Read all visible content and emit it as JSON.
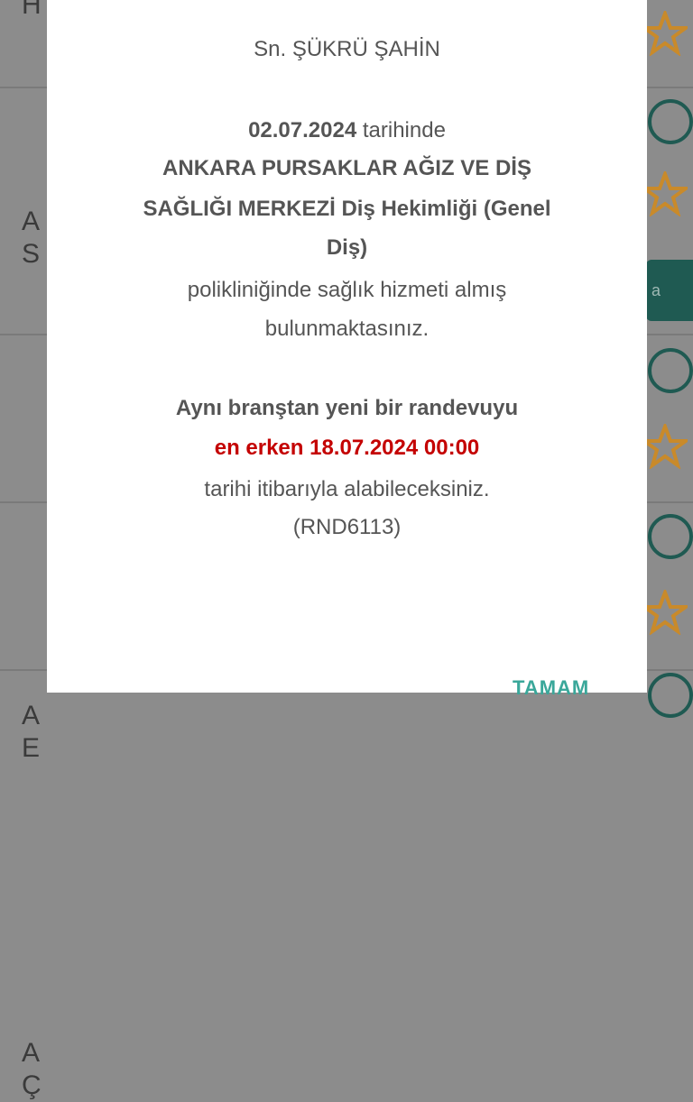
{
  "background": {
    "rows": [
      {
        "letters": "H"
      },
      {
        "letters": "A\nS"
      },
      {
        "letters": "A\nE"
      },
      {
        "letters": "A\nÇ"
      }
    ],
    "side_button_label": "a"
  },
  "dialog": {
    "salutation": "Sn. ŞÜKRÜ ŞAHİN",
    "date": "02.07.2024",
    "date_suffix": " tarihinde",
    "clinic_line1": "ANKARA PURSAKLAR AĞIZ VE DİŞ",
    "clinic_line2": "SAĞLIĞI MERKEZİ Diş Hekimliği (Genel",
    "clinic_line3": "Diş)",
    "service_line1": "polikliniğinde sağlık hizmeti almış",
    "service_line2": "bulunmaktasınız.",
    "branch_line": "Aynı branştan yeni bir randevuyu",
    "earliest_line": "en erken 18.07.2024 00:00",
    "from_line": "tarihi itibarıyla alabileceksiniz.",
    "code": "(RND6113)",
    "ok_label": "TAMAM"
  },
  "colors": {
    "accent": "#3aa79a",
    "warning": "#c40000",
    "dark_teal": "#1f5a52",
    "star": "#c98a2a"
  }
}
